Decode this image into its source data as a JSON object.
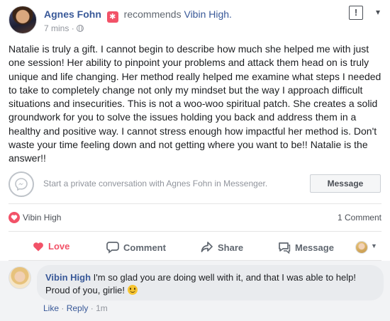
{
  "post": {
    "author": "Agnes Fohn",
    "recommends_text": "recommends",
    "page_name": "Vibin High.",
    "timestamp": "7 mins",
    "meta_separator": "·",
    "body": "Natalie is truly a gift. I cannot begin to describe how much she helped me with just one session! Her ability to pinpoint your problems and attack them head on is truly unique and life changing. Her method really helped me examine what steps I needed to take to completely change not only my mindset but the way I approach difficult situations and insecurities. This is not a woo-woo spiritual patch. She creates a solid groundwork for you to solve the issues holding you back and address them in a healthy and positive way. I cannot stress enough how impactful her method is. Don't waste your time feeling down and not getting where you want to be!! Natalie is the answer!!"
  },
  "messenger": {
    "prompt": "Start a private conversation with Agnes Fohn in Messenger.",
    "button_label": "Message"
  },
  "summary": {
    "page_name": "Vibin High",
    "comment_count": "1 Comment"
  },
  "actions": {
    "love": "Love",
    "comment": "Comment",
    "share": "Share",
    "message": "Message"
  },
  "comment": {
    "author": "Vibin High",
    "text": "I'm so glad you are doing well with it, and that I was able to help! Proud of you, girlie!",
    "like": "Like",
    "reply": "Reply",
    "separator": "·",
    "time": "1m"
  },
  "colors": {
    "link": "#385898",
    "love": "#f25268",
    "muted": "#90949c"
  }
}
